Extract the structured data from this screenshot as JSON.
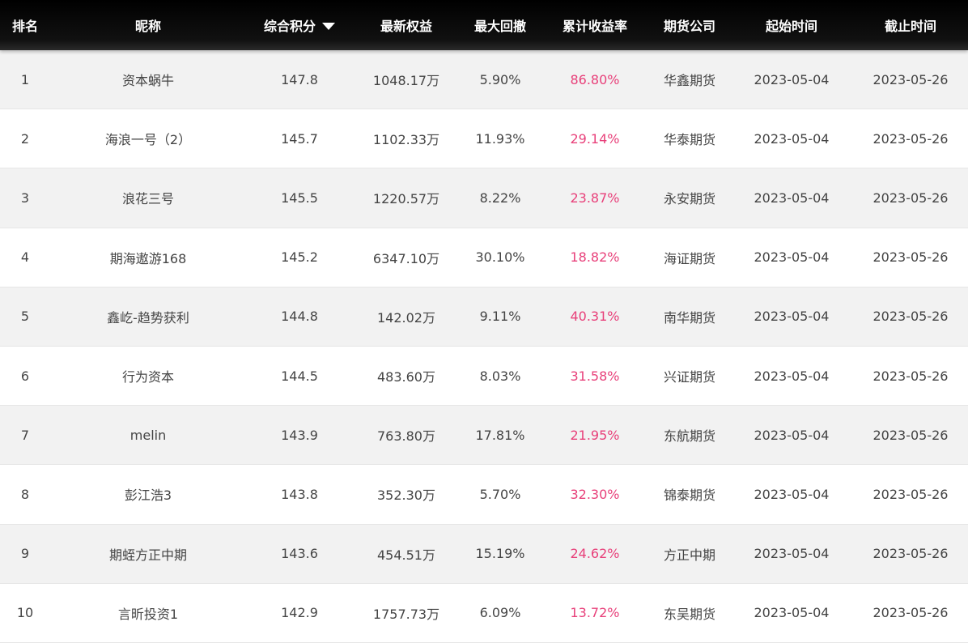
{
  "header": {
    "rank": "排名",
    "name": "昵称",
    "score": "综合积分",
    "equity": "最新权益",
    "drawdown": "最大回撤",
    "return": "累计收益率",
    "company": "期货公司",
    "start": "起始时间",
    "end": "截止时间"
  },
  "colors": {
    "header_bg": "#000000",
    "return_text": "#e8407a",
    "row_alt_bg": "#f2f2f2"
  },
  "icons": {
    "sort": "sort-desc-icon"
  },
  "rows": [
    {
      "rank": "1",
      "name": "资本蜗牛",
      "score": "147.8",
      "equity": "1048.17万",
      "drawdown": "5.90%",
      "return": "86.80%",
      "company": "华鑫期货",
      "start": "2023-05-04",
      "end": "2023-05-26"
    },
    {
      "rank": "2",
      "name": "海浪一号（2）",
      "score": "145.7",
      "equity": "1102.33万",
      "drawdown": "11.93%",
      "return": "29.14%",
      "company": "华泰期货",
      "start": "2023-05-04",
      "end": "2023-05-26"
    },
    {
      "rank": "3",
      "name": "浪花三号",
      "score": "145.5",
      "equity": "1220.57万",
      "drawdown": "8.22%",
      "return": "23.87%",
      "company": "永安期货",
      "start": "2023-05-04",
      "end": "2023-05-26"
    },
    {
      "rank": "4",
      "name": "期海遨游168",
      "score": "145.2",
      "equity": "6347.10万",
      "drawdown": "30.10%",
      "return": "18.82%",
      "company": "海证期货",
      "start": "2023-05-04",
      "end": "2023-05-26"
    },
    {
      "rank": "5",
      "name": "鑫屹-趋势获利",
      "score": "144.8",
      "equity": "142.02万",
      "drawdown": "9.11%",
      "return": "40.31%",
      "company": "南华期货",
      "start": "2023-05-04",
      "end": "2023-05-26"
    },
    {
      "rank": "6",
      "name": "行为资本",
      "score": "144.5",
      "equity": "483.60万",
      "drawdown": "8.03%",
      "return": "31.58%",
      "company": "兴证期货",
      "start": "2023-05-04",
      "end": "2023-05-26"
    },
    {
      "rank": "7",
      "name": "melin",
      "score": "143.9",
      "equity": "763.80万",
      "drawdown": "17.81%",
      "return": "21.95%",
      "company": "东航期货",
      "start": "2023-05-04",
      "end": "2023-05-26"
    },
    {
      "rank": "8",
      "name": "彭江浩3",
      "score": "143.8",
      "equity": "352.30万",
      "drawdown": "5.70%",
      "return": "32.30%",
      "company": "锦泰期货",
      "start": "2023-05-04",
      "end": "2023-05-26"
    },
    {
      "rank": "9",
      "name": "期蛭方正中期",
      "score": "143.6",
      "equity": "454.51万",
      "drawdown": "15.19%",
      "return": "24.62%",
      "company": "方正中期",
      "start": "2023-05-04",
      "end": "2023-05-26"
    },
    {
      "rank": "10",
      "name": "言昕投资1",
      "score": "142.9",
      "equity": "1757.73万",
      "drawdown": "6.09%",
      "return": "13.72%",
      "company": "东吴期货",
      "start": "2023-05-04",
      "end": "2023-05-26"
    }
  ]
}
